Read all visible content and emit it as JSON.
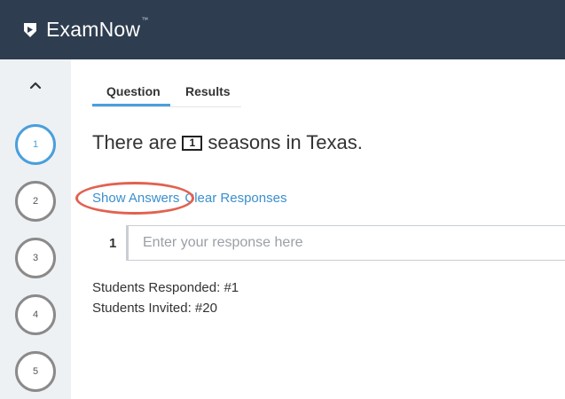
{
  "app": {
    "brand": "ExamNow",
    "trademark": "™"
  },
  "sidebar": {
    "questions": [
      {
        "label": "1",
        "active": true
      },
      {
        "label": "2",
        "active": false
      },
      {
        "label": "3",
        "active": false
      },
      {
        "label": "4",
        "active": false
      },
      {
        "label": "5",
        "active": false
      }
    ]
  },
  "tabs": [
    {
      "label": "Question",
      "active": true
    },
    {
      "label": "Results",
      "active": false
    }
  ],
  "question": {
    "prefix": "There are",
    "blank_number": "1",
    "suffix": "seasons in Texas."
  },
  "actions": {
    "show_answers": "Show Answers",
    "clear_responses": "Clear Responses"
  },
  "response": {
    "number": "1",
    "placeholder": "Enter your response here",
    "value": ""
  },
  "stats": {
    "responded": "Students Responded: #1",
    "invited": "Students Invited: #20"
  },
  "colors": {
    "topbar": "#2e3d4f",
    "accent": "#4a9fdc",
    "link": "#3a8fcf",
    "highlight": "#e26150",
    "sidebar_bg": "#eef1f4"
  },
  "icons": {
    "logo": "examnow-logo-icon",
    "collapse": "chevron-up-icon"
  }
}
